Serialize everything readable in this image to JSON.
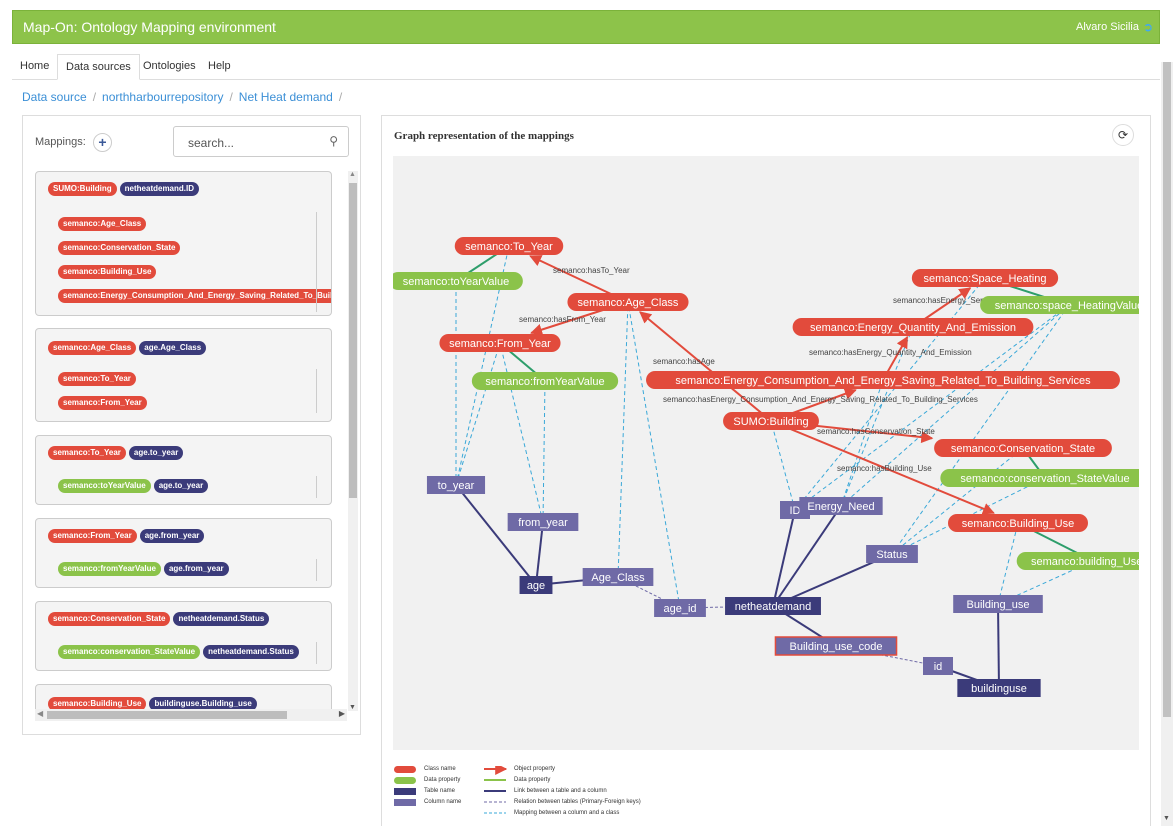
{
  "app": {
    "title": "Map-On: Ontology Mapping environment",
    "user": "Alvaro Sicilia",
    "logout_icon": "logout-icon"
  },
  "nav": {
    "tabs": [
      "Home",
      "Data sources",
      "Ontologies",
      "Help"
    ],
    "active": "Data sources"
  },
  "breadcrumb": [
    "Data source",
    "northharbourrepository",
    "Net Heat demand"
  ],
  "mappings_panel": {
    "label": "Mappings:",
    "add_icon": "plus-icon",
    "search_placeholder": "search...",
    "search_icon": "search-icon",
    "cards": [
      {
        "class": "SUMO:Building",
        "table": "netheatdemand.ID",
        "children": [
          {
            "kind": "class",
            "label": "semanco:Age_Class"
          },
          {
            "kind": "class",
            "label": "semanco:Conservation_State"
          },
          {
            "kind": "class",
            "label": "semanco:Building_Use"
          },
          {
            "kind": "class",
            "label": "semanco:Energy_Consumption_And_Energy_Saving_Related_To_Building_Services"
          }
        ]
      },
      {
        "class": "semanco:Age_Class",
        "table": "age.Age_Class",
        "children": [
          {
            "kind": "class",
            "label": "semanco:To_Year"
          },
          {
            "kind": "class",
            "label": "semanco:From_Year"
          }
        ]
      },
      {
        "class": "semanco:To_Year",
        "table": "age.to_year",
        "children": [
          {
            "kind": "data",
            "label": "semanco:toYearValue",
            "column": "age.to_year"
          }
        ]
      },
      {
        "class": "semanco:From_Year",
        "table": "age.from_year",
        "children": [
          {
            "kind": "data",
            "label": "semanco:fromYearValue",
            "column": "age.from_year"
          }
        ]
      },
      {
        "class": "semanco:Conservation_State",
        "table": "netheatdemand.Status",
        "children": [
          {
            "kind": "data",
            "label": "semanco:conservation_StateValue",
            "column": "netheatdemand.Status"
          }
        ]
      },
      {
        "class": "semanco:Building_Use",
        "table": "buildinguse.Building_use",
        "children": []
      }
    ]
  },
  "graph": {
    "title": "Graph representation of the mappings",
    "refresh_icon": "refresh-icon",
    "class_nodes": [
      "semanco:To_Year",
      "semanco:Age_Class",
      "semanco:From_Year",
      "semanco:Space_Heating",
      "semanco:Energy_Quantity_And_Emission",
      "semanco:Energy_Consumption_And_Energy_Saving_Related_To_Building_Services",
      "SUMO:Building",
      "semanco:Conservation_State",
      "semanco:Building_Use"
    ],
    "data_nodes": [
      "semanco:toYearValue",
      "semanco:fromYearValue",
      "semanco:space_HeatingValue",
      "semanco:conservation_StateValue",
      "semanco:building_UseVa"
    ],
    "table_nodes": [
      "age",
      "netheatdemand",
      "buildinguse"
    ],
    "column_nodes": [
      "to_year",
      "from_year",
      "Age_Class",
      "age_id",
      "ID",
      "Energy_Need",
      "Status",
      "Building_use",
      "Building_use_code",
      "id"
    ],
    "edge_labels": [
      "semanco:hasTo_Year",
      "semanco:hasFrom_Year",
      "semanco:hasAge",
      "semanco:hasEnergy_Service",
      "semanco:hasEnergy_Quantity_And_Emission",
      "semanco:hasEnergy_Consumption_And_Energy_Saving_Related_To_Building_Services",
      "semanco:hasConservation_State",
      "semanco:hasBuilding_Use"
    ]
  },
  "legend": {
    "items": [
      "Class name",
      "Data property",
      "Table name",
      "Column name",
      "Object property",
      "Data property",
      "Link between a table and a column",
      "Relation between tables (Primary-Foreign keys)",
      "Mapping between a column and a class"
    ]
  },
  "colors": {
    "class": "#e24b3c",
    "data": "#8bc34a",
    "table": "#3b3b7a",
    "column": "#6f6aa6",
    "mapping": "#3aa8d8",
    "header": "#8dc34a"
  }
}
